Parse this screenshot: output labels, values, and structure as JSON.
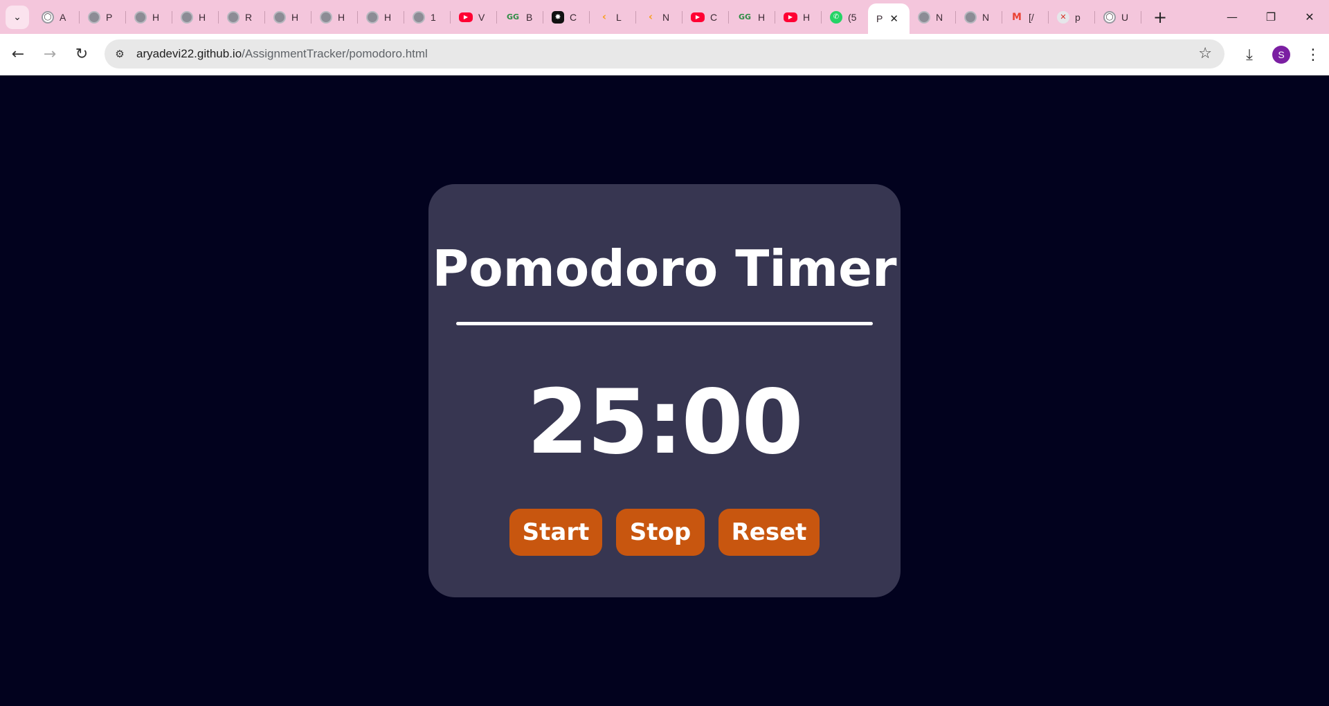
{
  "browser": {
    "tabs": [
      {
        "icon": "github-icon",
        "label": "A"
      },
      {
        "icon": "globe-icon",
        "label": "P"
      },
      {
        "icon": "globe-icon",
        "label": "H"
      },
      {
        "icon": "globe-icon",
        "label": "H"
      },
      {
        "icon": "globe-icon",
        "label": "R"
      },
      {
        "icon": "globe-icon",
        "label": "H"
      },
      {
        "icon": "globe-icon",
        "label": "H"
      },
      {
        "icon": "globe-icon",
        "label": "H"
      },
      {
        "icon": "globe-icon",
        "label": "1"
      },
      {
        "icon": "youtube-icon",
        "label": "V"
      },
      {
        "icon": "geeksforgeeks-icon",
        "label": "B"
      },
      {
        "icon": "chatgpt-icon",
        "label": "C"
      },
      {
        "icon": "leetcode-icon",
        "label": "L"
      },
      {
        "icon": "leetcode-icon",
        "label": "N"
      },
      {
        "icon": "youtube-icon",
        "label": "C"
      },
      {
        "icon": "geeksforgeeks-icon",
        "label": "H"
      },
      {
        "icon": "youtube-icon",
        "label": "H"
      },
      {
        "icon": "whatsapp-icon",
        "label": "(5"
      },
      {
        "icon": "none",
        "label": "P",
        "active": true
      },
      {
        "icon": "globe-icon",
        "label": "N"
      },
      {
        "icon": "globe-icon",
        "label": "N"
      },
      {
        "icon": "gmail-icon",
        "label": "[/"
      },
      {
        "icon": "error-icon",
        "label": "p"
      },
      {
        "icon": "github-icon",
        "label": "U"
      }
    ],
    "url_host": "aryadevi22.github.io",
    "url_path": "/AssignmentTracker/pomodoro.html",
    "profile_initial": "S",
    "colors": {
      "tabstrip": "#f4c6dc",
      "avatar": "#7b1fa2"
    }
  },
  "page": {
    "title": "Pomodoro Timer",
    "timer": "25:00",
    "buttons": {
      "start": "Start",
      "stop": "Stop",
      "reset": "Reset"
    },
    "colors": {
      "background": "#02021e",
      "card": "#373651",
      "button": "#c8560f",
      "text": "#ffffff"
    }
  }
}
